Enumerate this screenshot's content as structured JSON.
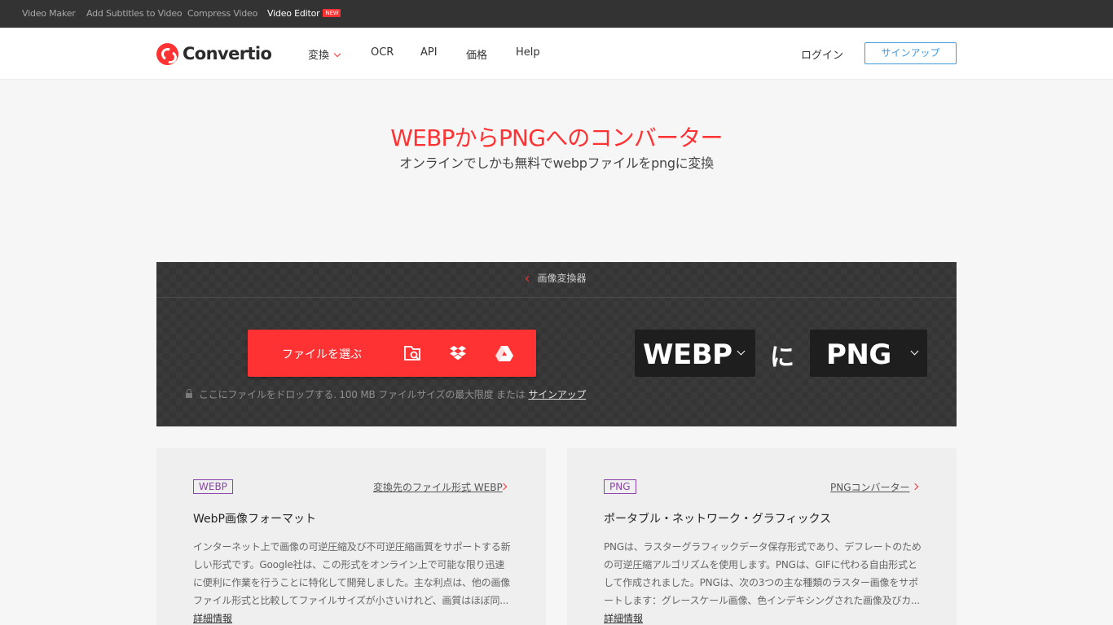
{
  "topbar": {
    "links": [
      {
        "label": "Video Maker"
      },
      {
        "label": "Add Subtitles to Video"
      },
      {
        "label": "Compress Video"
      },
      {
        "label": "Video Editor",
        "badge": "NEW"
      }
    ]
  },
  "header": {
    "logo_text": "Convertio",
    "nav": [
      {
        "label": "変換"
      },
      {
        "label": "OCR"
      },
      {
        "label": "API"
      },
      {
        "label": "価格"
      },
      {
        "label": "Help"
      }
    ],
    "login": "ログイン",
    "signup": "サインアップ"
  },
  "hero": {
    "title": "WEBPからPNGへのコンバーター",
    "subtitle": "オンラインでしかも無料でwebpファイルをpngに変換"
  },
  "converter": {
    "breadcrumb": "画像変換器",
    "choose_label": "ファイルを選ぶ",
    "drop_hint": "ここにファイルをドロップする. 100 MB ファイルサイズの最大限度 または",
    "drop_link": "サインアップ",
    "from_format": "WEBP",
    "connector": "に",
    "to_format": "PNG"
  },
  "cards": [
    {
      "badge": "WEBP",
      "link": "変換先のファイル形式 WEBP",
      "title": "WebP画像フォーマット",
      "description": "インターネット上で画像の可逆圧縮及び不可逆圧縮画質をサポートする新しい形式です。Google社は、この形式をオンライン上で可能な限り迅速に便利に作業を行うことに特化して開発しました。主な利点は、他の画像ファイル形式と比較してファイルサイズが小さいけれど、画質はほぼ同...",
      "more": "詳細情報"
    },
    {
      "badge": "PNG",
      "link": "PNGコンバーター",
      "title": "ポータブル・ネットワーク・グラフィックス",
      "description": "PNGは、ラスターグラフィックデータ保存形式であり、デフレートのための可逆圧縮アルゴリズムを使用します。PNGは、GIFに代わる自由形式として作成されました。PNGは、次の3つの主な種類のラスター画像をサポートします：グレースケール画像、色インデキシングされた画像及びカ...",
      "more": "詳細情報"
    }
  ],
  "colors": {
    "accent": "#ff3233",
    "link_blue": "#3f9ae0",
    "badge_purple": "#8e44ad",
    "topbar_bg": "#333333"
  },
  "icons": [
    "logo-icon",
    "chevron-down-icon",
    "search-file-icon",
    "dropbox-icon",
    "google-drive-icon",
    "lock-icon",
    "chevron-left-icon",
    "chevron-right-icon"
  ]
}
